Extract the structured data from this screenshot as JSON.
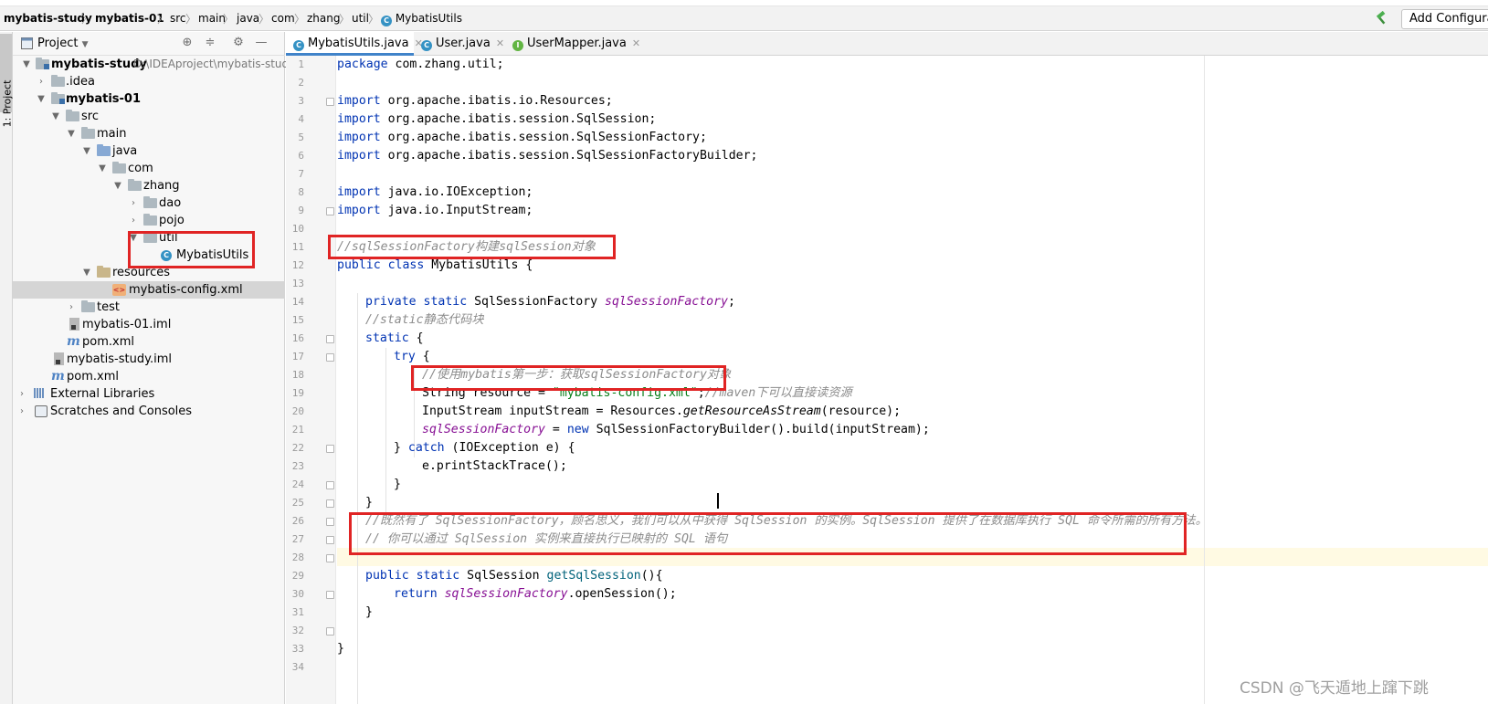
{
  "breadcrumb": {
    "items": [
      "mybatis-study",
      "mybatis-01",
      "src",
      "main",
      "java",
      "com",
      "zhang",
      "util",
      "MybatisUtils"
    ],
    "separator": "〉"
  },
  "toolbar": {
    "add_configuration": "Add Configuration..."
  },
  "left_stripe": {
    "project_label": "1: Project"
  },
  "project_panel": {
    "title": "Project",
    "tree": [
      {
        "label": "mybatis-study",
        "path": "D:\\IDEAproject\\mybatis-study",
        "bold": true
      },
      {
        "label": ".idea"
      },
      {
        "label": "mybatis-01",
        "bold": true
      },
      {
        "label": "src"
      },
      {
        "label": "main"
      },
      {
        "label": "java"
      },
      {
        "label": "com"
      },
      {
        "label": "zhang"
      },
      {
        "label": "dao"
      },
      {
        "label": "pojo"
      },
      {
        "label": "util"
      },
      {
        "label": "MybatisUtils"
      },
      {
        "label": "resources"
      },
      {
        "label": "mybatis-config.xml"
      },
      {
        "label": "test"
      },
      {
        "label": "mybatis-01.iml"
      },
      {
        "label": "pom.xml"
      },
      {
        "label": "mybatis-study.iml"
      },
      {
        "label": "pom.xml"
      },
      {
        "label": "External Libraries"
      },
      {
        "label": "Scratches and Consoles"
      }
    ]
  },
  "tabs": [
    {
      "label": "MybatisUtils.java",
      "active": true
    },
    {
      "label": "User.java",
      "active": false
    },
    {
      "label": "UserMapper.java",
      "active": false
    }
  ],
  "editor": {
    "line_numbers": [
      "1",
      "2",
      "3",
      "4",
      "5",
      "6",
      "7",
      "8",
      "9",
      "10",
      "11",
      "12",
      "13",
      "14",
      "15",
      "16",
      "17",
      "18",
      "19",
      "20",
      "21",
      "22",
      "23",
      "24",
      "25",
      "26",
      "27",
      "28",
      "29",
      "30",
      "31",
      "32",
      "33",
      "34"
    ],
    "current_line": 27
  },
  "code": {
    "l1_kw": "package",
    "l1_rest": " com.zhang.util;",
    "l3_kw": "import",
    "l3_rest": " org.apache.ibatis.io.Resources;",
    "l4_kw": "import",
    "l4_rest": " org.apache.ibatis.session.SqlSession;",
    "l5_kw": "import",
    "l5_rest": " org.apache.ibatis.session.SqlSessionFactory;",
    "l6_kw": "import",
    "l6_rest": " org.apache.ibatis.session.SqlSessionFactoryBuilder;",
    "l8_kw": "import",
    "l8_rest": " java.io.IOException;",
    "l9_kw": "import",
    "l9_rest": " java.io.InputStream;",
    "l11_cm": "//sqlSessionFactory构建sqlSession对象",
    "l12_kw": "public class",
    "l12_rest": " MybatisUtils {",
    "l14_kw": "private static",
    "l14_type": " SqlSessionFactory ",
    "l14_field": "sqlSessionFactory",
    "l14_end": ";",
    "l15_cm": "//static静态代码块",
    "l16_kw": "static",
    "l16_rest": " {",
    "l17_kw": "try",
    "l17_rest": " {",
    "l18_cm": "//使用mybatis第一步：获取sqlSessionFactory对象",
    "l19_a": "String resource = ",
    "l19_str": "\"mybatis-config.xml\"",
    "l19_b": ";",
    "l19_cm": "//maven下可以直接读资源",
    "l20_a": "InputStream inputStream = Resources.",
    "l20_st": "getResourceAsStream",
    "l20_b": "(resource);",
    "l21_field": "sqlSessionFactory",
    "l21_a": " = ",
    "l21_kw": "new",
    "l21_b": " SqlSessionFactoryBuilder().build(inputStream);",
    "l22_a": "} ",
    "l22_kw": "catch",
    "l22_b": " (IOException e) {",
    "l23": "e.printStackTrace();",
    "l24": "}",
    "l25": "}",
    "l26_cm": "//既然有了 SqlSessionFactory，顾名思义，我们可以从中获得 SqlSession 的实例。SqlSession 提供了在数据库执行 SQL 命令所需的所有方法。",
    "l27_cm": "// 你可以通过 SqlSession 实例来直接执行已映射的 SQL 语句",
    "l29_kw": "public static",
    "l29_rest": " SqlSession ",
    "l29_method": "getSqlSession",
    "l29_end": "(){",
    "l30_kw": "return",
    "l30_sp": " ",
    "l30_field": "sqlSessionFactory",
    "l30_rest": ".openSession();",
    "l31": "}",
    "l33": "}"
  },
  "watermark": "CSDN @飞天遁地上蹿下跳",
  "colors": {
    "keyword": "#0033b3",
    "comment": "#8c8c8c",
    "field": "#871094",
    "string": "#067d17",
    "highlight_box": "#e02424",
    "tab_underline": "#4083c9"
  }
}
